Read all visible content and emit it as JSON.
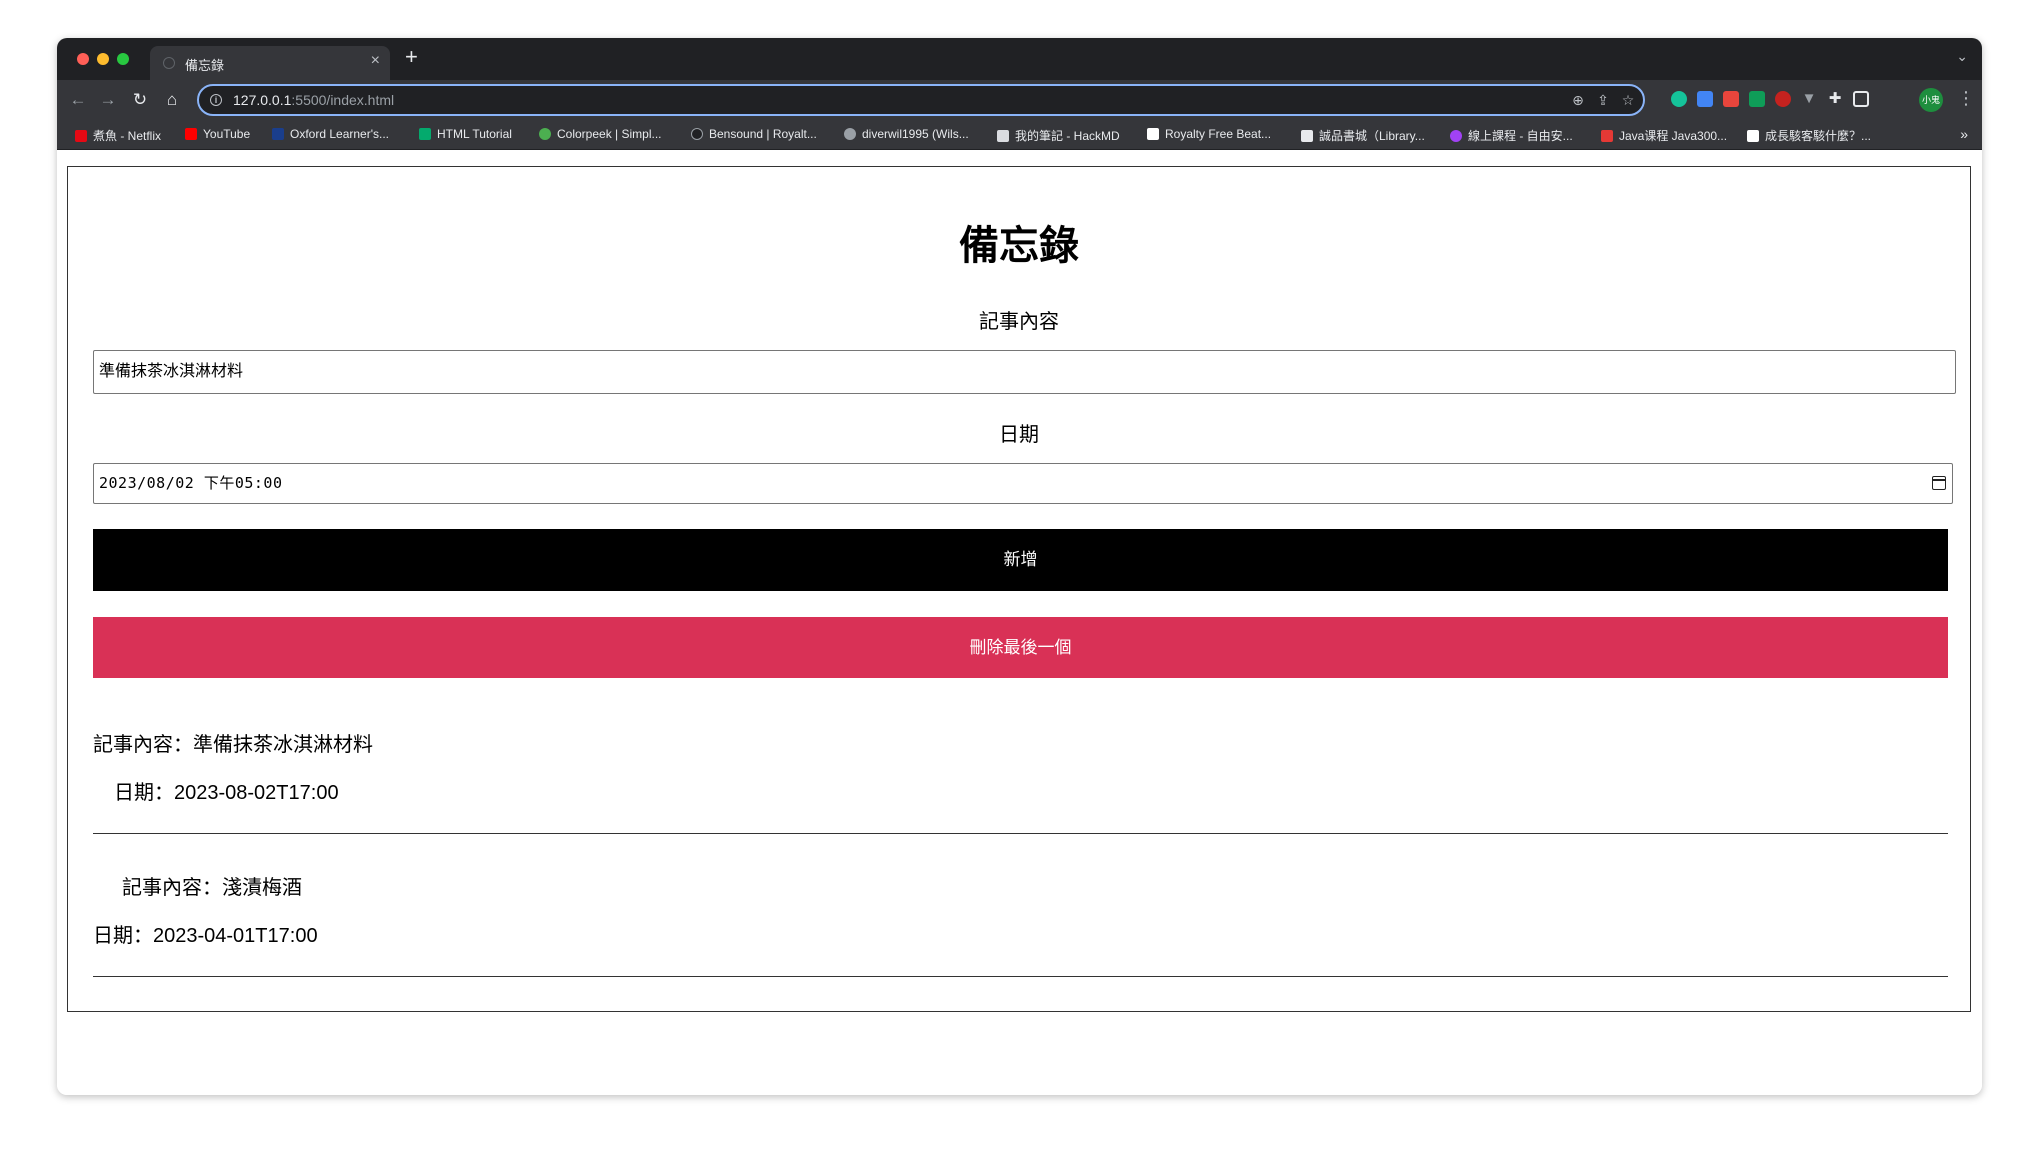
{
  "browser": {
    "tab": {
      "title": "備忘錄",
      "close": "×"
    },
    "new_tab": "+",
    "tab_menu": "⌄",
    "nav": {
      "back": "←",
      "forward": "→",
      "reload": "↻",
      "home": "⌂"
    },
    "url_host": "127.0.0.1",
    "url_rest": ":5500/index.html",
    "omnibox_icons": [
      "zoom-icon",
      "share-icon",
      "star-icon"
    ],
    "extensions": [
      {
        "name": "grammarly",
        "color": "#15c39a"
      },
      {
        "name": "translate",
        "color": "#4285f4"
      },
      {
        "name": "extension-red",
        "color": "#e8453c"
      },
      {
        "name": "extension-green",
        "color": "#0f9d58"
      },
      {
        "name": "extension-gear",
        "color": "#c5221f"
      },
      {
        "name": "vue-devtools",
        "color": "#9aa0a6"
      },
      {
        "name": "puzzle",
        "color": "#e8eaed"
      },
      {
        "name": "side-panel",
        "color": "#e8eaed"
      }
    ],
    "profile": "小鬼",
    "kebab": "⋮",
    "bookmarks": [
      {
        "label": "煮魚 - Netflix",
        "color": "#e50914"
      },
      {
        "label": "YouTube",
        "color": "#ff0000"
      },
      {
        "label": "Oxford Learner's...",
        "color": "#1a3e8c"
      },
      {
        "label": "HTML Tutorial",
        "color": "#04aa6d"
      },
      {
        "label": "Colorpeek | Simpl...",
        "color": "#4caf50"
      },
      {
        "label": "Bensound | Royalt...",
        "color": "#202124"
      },
      {
        "label": "diverwil1995 (Wils...",
        "color": "#9aa0a6"
      },
      {
        "label": "我的筆記 - HackMD",
        "color": "#dadce0"
      },
      {
        "label": "Royalty Free Beat...",
        "color": "#ffffff"
      },
      {
        "label": "誠品書城（Library...",
        "color": "#e8eaed"
      },
      {
        "label": "線上課程 - 自由安...",
        "color": "#a142f4"
      },
      {
        "label": "Java课程 Java300...",
        "color": "#e53935"
      },
      {
        "label": "成長駭客駭什麼？...",
        "color": "#ffffff"
      }
    ],
    "bookmarks_more": "»"
  },
  "app": {
    "title": "備忘錄",
    "content_label": "記事內容",
    "content_value": "準備抹茶冰淇淋材料",
    "date_label": "日期",
    "date_value": "2023/08/02  下午05:00",
    "add_button": "新增",
    "delete_button": "刪除最後一個",
    "memos": [
      {
        "content": "記事內容：準備抹茶冰淇淋材料",
        "date": "日期：2023-08-02T17:00"
      },
      {
        "content": "記事內容：淺漬梅酒",
        "date": "日期：2023-04-01T17:00"
      }
    ]
  }
}
